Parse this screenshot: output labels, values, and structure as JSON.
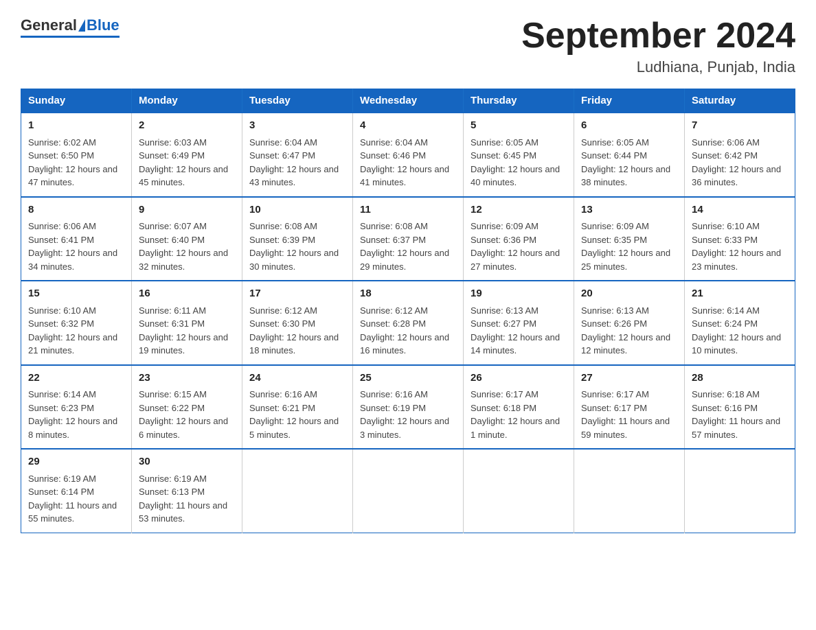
{
  "logo": {
    "general": "General",
    "blue": "Blue"
  },
  "title": "September 2024",
  "subtitle": "Ludhiana, Punjab, India",
  "days_of_week": [
    "Sunday",
    "Monday",
    "Tuesday",
    "Wednesday",
    "Thursday",
    "Friday",
    "Saturday"
  ],
  "weeks": [
    [
      {
        "day": "1",
        "sunrise": "6:02 AM",
        "sunset": "6:50 PM",
        "daylight": "12 hours and 47 minutes."
      },
      {
        "day": "2",
        "sunrise": "6:03 AM",
        "sunset": "6:49 PM",
        "daylight": "12 hours and 45 minutes."
      },
      {
        "day": "3",
        "sunrise": "6:04 AM",
        "sunset": "6:47 PM",
        "daylight": "12 hours and 43 minutes."
      },
      {
        "day": "4",
        "sunrise": "6:04 AM",
        "sunset": "6:46 PM",
        "daylight": "12 hours and 41 minutes."
      },
      {
        "day": "5",
        "sunrise": "6:05 AM",
        "sunset": "6:45 PM",
        "daylight": "12 hours and 40 minutes."
      },
      {
        "day": "6",
        "sunrise": "6:05 AM",
        "sunset": "6:44 PM",
        "daylight": "12 hours and 38 minutes."
      },
      {
        "day": "7",
        "sunrise": "6:06 AM",
        "sunset": "6:42 PM",
        "daylight": "12 hours and 36 minutes."
      }
    ],
    [
      {
        "day": "8",
        "sunrise": "6:06 AM",
        "sunset": "6:41 PM",
        "daylight": "12 hours and 34 minutes."
      },
      {
        "day": "9",
        "sunrise": "6:07 AM",
        "sunset": "6:40 PM",
        "daylight": "12 hours and 32 minutes."
      },
      {
        "day": "10",
        "sunrise": "6:08 AM",
        "sunset": "6:39 PM",
        "daylight": "12 hours and 30 minutes."
      },
      {
        "day": "11",
        "sunrise": "6:08 AM",
        "sunset": "6:37 PM",
        "daylight": "12 hours and 29 minutes."
      },
      {
        "day": "12",
        "sunrise": "6:09 AM",
        "sunset": "6:36 PM",
        "daylight": "12 hours and 27 minutes."
      },
      {
        "day": "13",
        "sunrise": "6:09 AM",
        "sunset": "6:35 PM",
        "daylight": "12 hours and 25 minutes."
      },
      {
        "day": "14",
        "sunrise": "6:10 AM",
        "sunset": "6:33 PM",
        "daylight": "12 hours and 23 minutes."
      }
    ],
    [
      {
        "day": "15",
        "sunrise": "6:10 AM",
        "sunset": "6:32 PM",
        "daylight": "12 hours and 21 minutes."
      },
      {
        "day": "16",
        "sunrise": "6:11 AM",
        "sunset": "6:31 PM",
        "daylight": "12 hours and 19 minutes."
      },
      {
        "day": "17",
        "sunrise": "6:12 AM",
        "sunset": "6:30 PM",
        "daylight": "12 hours and 18 minutes."
      },
      {
        "day": "18",
        "sunrise": "6:12 AM",
        "sunset": "6:28 PM",
        "daylight": "12 hours and 16 minutes."
      },
      {
        "day": "19",
        "sunrise": "6:13 AM",
        "sunset": "6:27 PM",
        "daylight": "12 hours and 14 minutes."
      },
      {
        "day": "20",
        "sunrise": "6:13 AM",
        "sunset": "6:26 PM",
        "daylight": "12 hours and 12 minutes."
      },
      {
        "day": "21",
        "sunrise": "6:14 AM",
        "sunset": "6:24 PM",
        "daylight": "12 hours and 10 minutes."
      }
    ],
    [
      {
        "day": "22",
        "sunrise": "6:14 AM",
        "sunset": "6:23 PM",
        "daylight": "12 hours and 8 minutes."
      },
      {
        "day": "23",
        "sunrise": "6:15 AM",
        "sunset": "6:22 PM",
        "daylight": "12 hours and 6 minutes."
      },
      {
        "day": "24",
        "sunrise": "6:16 AM",
        "sunset": "6:21 PM",
        "daylight": "12 hours and 5 minutes."
      },
      {
        "day": "25",
        "sunrise": "6:16 AM",
        "sunset": "6:19 PM",
        "daylight": "12 hours and 3 minutes."
      },
      {
        "day": "26",
        "sunrise": "6:17 AM",
        "sunset": "6:18 PM",
        "daylight": "12 hours and 1 minute."
      },
      {
        "day": "27",
        "sunrise": "6:17 AM",
        "sunset": "6:17 PM",
        "daylight": "11 hours and 59 minutes."
      },
      {
        "day": "28",
        "sunrise": "6:18 AM",
        "sunset": "6:16 PM",
        "daylight": "11 hours and 57 minutes."
      }
    ],
    [
      {
        "day": "29",
        "sunrise": "6:19 AM",
        "sunset": "6:14 PM",
        "daylight": "11 hours and 55 minutes."
      },
      {
        "day": "30",
        "sunrise": "6:19 AM",
        "sunset": "6:13 PM",
        "daylight": "11 hours and 53 minutes."
      },
      null,
      null,
      null,
      null,
      null
    ]
  ],
  "labels": {
    "sunrise": "Sunrise:",
    "sunset": "Sunset:",
    "daylight": "Daylight:"
  }
}
